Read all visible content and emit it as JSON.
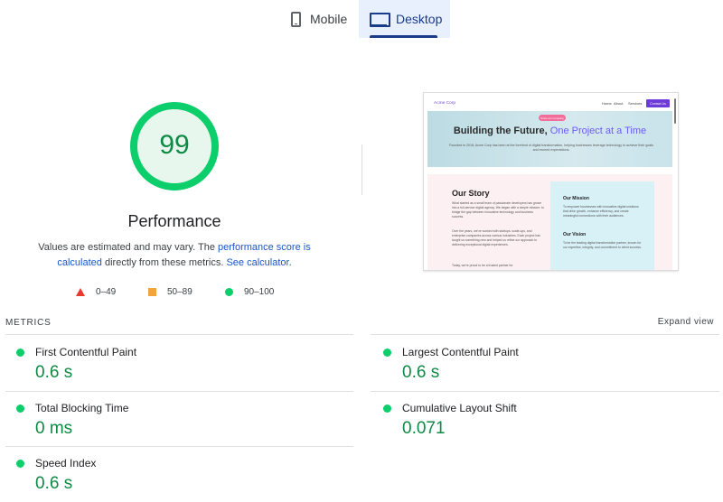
{
  "tabs": {
    "mobile": "Mobile",
    "desktop": "Desktop",
    "active": "desktop"
  },
  "score": {
    "value": "99",
    "fraction": 0.99,
    "title": "Performance",
    "desc_prefix": "Values are estimated and may vary. The ",
    "desc_link1": "performance score is calculated",
    "desc_middle": " directly from these metrics. ",
    "desc_link2": "See calculator.",
    "ring_color": "#0cce6b",
    "fill_color": "#e8f7ee",
    "text_color": "#0d8a43"
  },
  "legend": [
    {
      "shape": "triangle",
      "color": "#e8392f",
      "label": "0–49"
    },
    {
      "shape": "square",
      "color": "#f2a53a",
      "label": "50–89"
    },
    {
      "shape": "circle",
      "color": "#0cce6b",
      "label": "90–100"
    }
  ],
  "preview": {
    "brand": "Acme Corp",
    "nav": [
      "Home",
      "About",
      "Services"
    ],
    "cta": "Contact Us",
    "badge": "Since our company",
    "hero_title": "Building the Future, ",
    "hero_accent": "One Project at a Time",
    "hero_sub": "Founded in 2018, Acme Corp has been at the forefront of digital transformation, helping businesses leverage technology to achieve their goals and exceed expectations.",
    "story_title": "Our Story",
    "story_p1": "What started as a small team of passionate developers has grown into a full-service digital agency. We began with a simple mission: to bridge the gap between innovative technology and business success.",
    "story_p2": "Over the years, we've worked with startups, scale-ups, and enterprise companies across various industries. Each project has taught us something new and helped us refine our approach to delivering exceptional digital experiences.",
    "story_p3": "Today, we're proud to be a trusted partner for",
    "mission_title": "Our Mission",
    "mission_text": "To empower businesses with innovative digital solutions that drive growth, enhance efficiency, and create meaningful connections with their audiences.",
    "vision_title": "Our Vision",
    "vision_text": "To be the leading digital transformation partner, known for our expertise, integrity, and commitment to client success."
  },
  "metrics": {
    "header": "METRICS",
    "expand": "Expand view",
    "items": [
      {
        "name": "First Contentful Paint",
        "value": "0.6 s"
      },
      {
        "name": "Largest Contentful Paint",
        "value": "0.6 s"
      },
      {
        "name": "Total Blocking Time",
        "value": "0 ms"
      },
      {
        "name": "Cumulative Layout Shift",
        "value": "0.071"
      },
      {
        "name": "Speed Index",
        "value": "0.6 s"
      }
    ]
  }
}
